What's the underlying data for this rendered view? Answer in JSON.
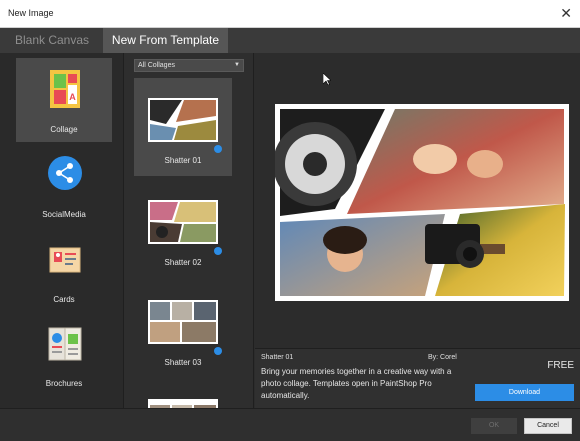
{
  "window": {
    "title": "New Image"
  },
  "tabs": [
    {
      "label": "Blank Canvas",
      "active": false
    },
    {
      "label": "New From Template",
      "active": true
    }
  ],
  "categories": [
    {
      "label": "Collage",
      "icon": "collage-icon",
      "selected": true
    },
    {
      "label": "SocialMedia",
      "icon": "share-icon",
      "selected": false
    },
    {
      "label": "Cards",
      "icon": "card-icon",
      "selected": false
    },
    {
      "label": "Brochures",
      "icon": "brochure-icon",
      "selected": false
    }
  ],
  "filter": {
    "value": "All Collages"
  },
  "templates": [
    {
      "label": "Shatter 01",
      "selected": true
    },
    {
      "label": "Shatter 02",
      "selected": false
    },
    {
      "label": "Shatter 03",
      "selected": false
    }
  ],
  "details": {
    "name": "Shatter 01",
    "author": "By: Corel",
    "price": "FREE",
    "description": "Bring your memories together in a creative way with a photo collage. Templates open in PaintShop Pro automatically.",
    "download_label": "Download"
  },
  "footer": {
    "ok_label": "OK",
    "cancel_label": "Cancel"
  },
  "colors": {
    "accent": "#2c8de6",
    "background": "#2b2b2b",
    "selected": "#4a4a4a"
  }
}
